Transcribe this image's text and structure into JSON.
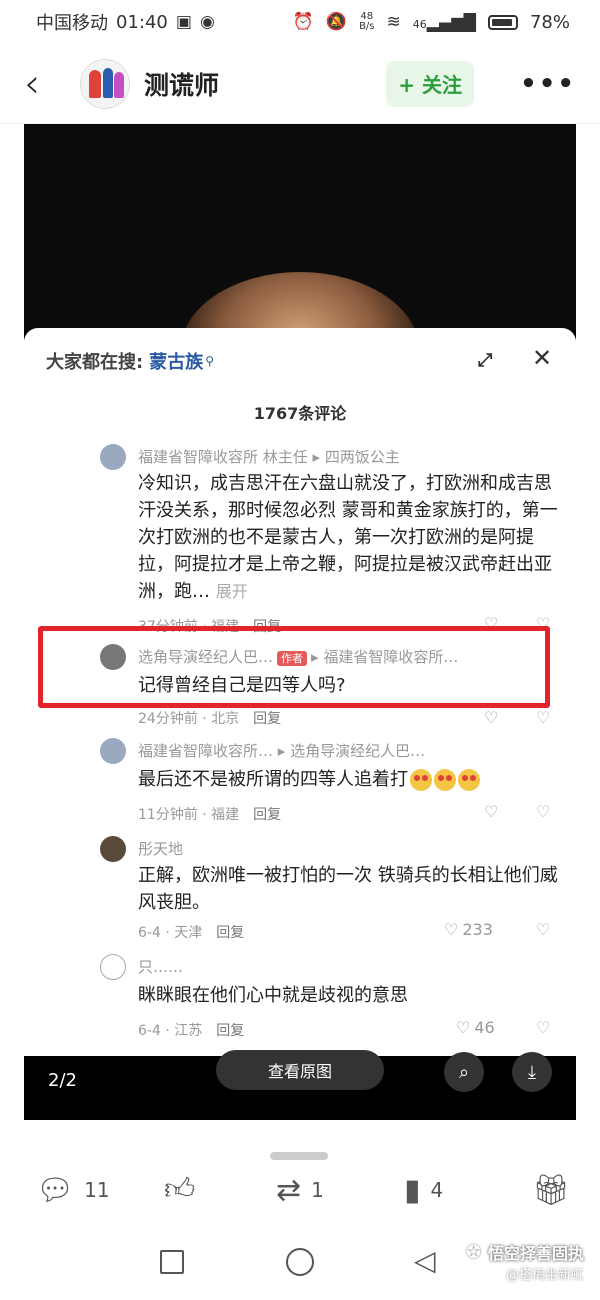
{
  "status_bar": {
    "carrier": "中国移动",
    "time": "01:40",
    "net_speed_value": "48",
    "net_speed_unit": "B/s",
    "signal_label": "46",
    "battery": "78%"
  },
  "header": {
    "channel_name": "测谎师",
    "follow_label": "+ 关注"
  },
  "panel": {
    "search_label": "大家都在搜:",
    "search_term": "蒙古族",
    "comment_count": "1767条评论",
    "comments": [
      {
        "meta": "福建省智障收容所 林主任 ▸ 四两饭公主",
        "text": "冷知识，成吉思汗在六盘山就没了，打欧洲和成吉思汗没关系，那时候忽必烈 蒙哥和黄金家族打的，第一次打欧洲的也不是蒙古人，第一次打欧洲的是阿提拉，阿提拉才是上帝之鞭，阿提拉是被汉武帝赶出亚洲，跑…",
        "expand": "展开",
        "time": "37分钟前 · 福建",
        "reply": "回复"
      },
      {
        "meta_user": "选角导演经纪人巴…",
        "meta_tag": "作者",
        "meta_target": "▸ 福建省智障收容所…",
        "text": "记得曾经自己是四等人吗?",
        "time": "24分钟前 · 北京",
        "reply": "回复"
      },
      {
        "meta": "福建省智障收容所… ▸ 选角导演经纪人巴…",
        "text": "最后还不是被所谓的四等人追着打",
        "time": "11分钟前 · 福建",
        "reply": "回复"
      },
      {
        "meta": "彤天地",
        "text": "正解，欧洲唯一被打怕的一次 铁骑兵的长相让他们威风丧胆。",
        "time": "6-4 · 天津",
        "reply": "回复",
        "likes": "233"
      },
      {
        "meta": "只……",
        "text": "眯眯眼在他们心中就是歧视的意思",
        "time": "6-4 · 江苏",
        "reply": "回复",
        "likes": "46"
      }
    ]
  },
  "shot_bottom": {
    "page_indicator": "2/2",
    "view_original": "查看原图"
  },
  "actions": {
    "comments": "11",
    "reposts": "1",
    "favorites": "4"
  },
  "watermark": {
    "main": "悟空择善固执",
    "sub": "@搭梅坐新虹"
  },
  "colors": {
    "accent_green": "#2a9d3c",
    "highlight_red": "#e3242b",
    "search_blue": "#2b5aa3"
  }
}
